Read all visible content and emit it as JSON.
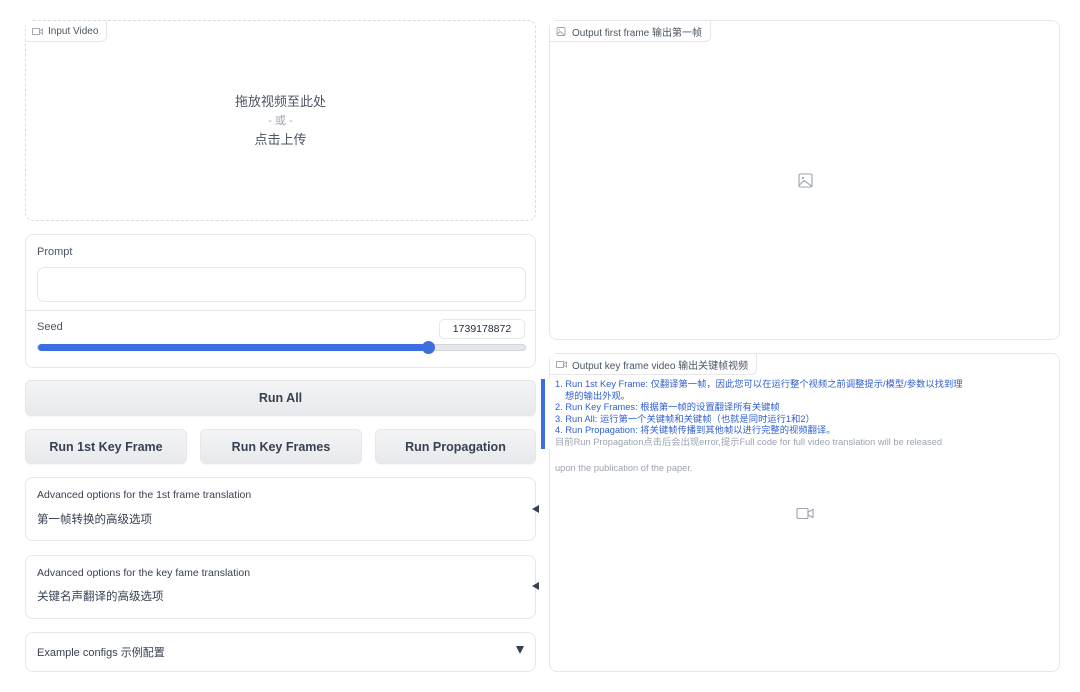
{
  "input_video": {
    "label": "Input Video",
    "icon": "video-icon",
    "drop_text": "拖放视频至此处",
    "or_text": "- 或 -",
    "click_text": "点击上传"
  },
  "prompt": {
    "label": "Prompt",
    "value": "",
    "placeholder": ""
  },
  "seed": {
    "label": "Seed",
    "value": "1739178872",
    "slider_fraction": 0.8
  },
  "buttons": {
    "run_all": "Run All",
    "run_first": "Run 1st Key Frame",
    "run_keys": "Run Key Frames",
    "run_propagation": "Run Propagation"
  },
  "accordions": {
    "first": {
      "title": "Advanced options for the 1st frame translation",
      "subtitle": "第一帧转换的高级选项",
      "icon": "collapse-left-icon"
    },
    "key": {
      "title": "Advanced options for the key fame translation",
      "subtitle": "关键名声翻译的高级选项",
      "icon": "collapse-left-icon"
    },
    "examples": {
      "title": "Example configs 示例配置",
      "icon": "expand-down-icon"
    }
  },
  "output_first": {
    "label": "Output first frame 输出第一帧",
    "icon": "image-icon"
  },
  "output_video": {
    "label": "Output key frame video 输出关键帧视频",
    "icon": "video-icon"
  },
  "notes": {
    "items": [
      "1. Run 1st Key Frame: 仅翻译第一帧，因此您可以在运行整个视频之前调整提示/模型/参数以找到理",
      "想的输出外观。",
      "2. Run Key Frames: 根据第一帧的设置翻译所有关键帧",
      "3. Run All: 运行第一个关键帧和关键帧（也就是同时运行1和2）",
      "4. Run Propagation: 将关键帧传播到其他帧以进行完整的视频翻译。"
    ],
    "warning_line1": "目前Run Propagation点击后会出现error,提示Full code for full video translation will be released",
    "warning_line2": "upon the publication of the paper."
  },
  "colors": {
    "accent": "#3b6fe0",
    "note_text": "#2f5fd0",
    "muted": "#9ca3af"
  }
}
